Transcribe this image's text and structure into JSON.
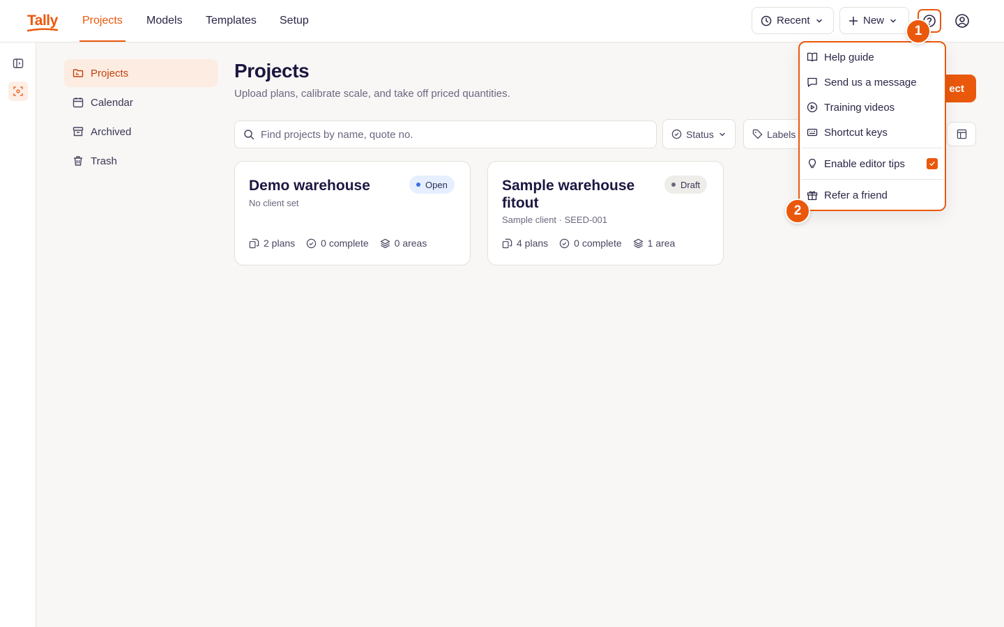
{
  "app": {
    "logo": "Tally",
    "accent": "#ea580c"
  },
  "nav": {
    "tabs": [
      {
        "label": "Projects",
        "active": true
      },
      {
        "label": "Models"
      },
      {
        "label": "Templates"
      },
      {
        "label": "Setup"
      }
    ]
  },
  "toolbar": {
    "recent_label": "Recent",
    "new_label": "New"
  },
  "rail": {
    "icons": [
      "sidebar-toggle-icon",
      "scan-icon"
    ]
  },
  "sidenav": {
    "items": [
      {
        "label": "Projects",
        "icon": "folder-icon",
        "active": true
      },
      {
        "label": "Calendar",
        "icon": "calendar-icon"
      },
      {
        "label": "Archived",
        "icon": "archive-icon"
      },
      {
        "label": "Trash",
        "icon": "trash-icon"
      }
    ]
  },
  "main": {
    "title": "Projects",
    "subtitle": "Upload plans, calibrate scale, and take off priced quantities.",
    "new_project_label": "ect",
    "search": {
      "placeholder": "Find projects by name, quote no.",
      "value": ""
    },
    "filters": {
      "status": "Status",
      "labels": "Labels"
    }
  },
  "projects": [
    {
      "title": "Demo warehouse",
      "client": "No client set",
      "status": "Open",
      "plans": "2 plans",
      "complete": "0 complete",
      "areas": "0 areas"
    },
    {
      "title": "Sample warehouse fitout",
      "client": "Sample client · SEED-001",
      "status": "Draft",
      "plans": "4 plans",
      "complete": "0 complete",
      "areas": "1 area"
    }
  ],
  "help_menu": {
    "items": [
      {
        "label": "Help guide",
        "icon": "book-icon"
      },
      {
        "label": "Send us a message",
        "icon": "message-icon"
      },
      {
        "label": "Training videos",
        "icon": "play-circle-icon"
      },
      {
        "label": "Shortcut keys",
        "icon": "keyboard-icon"
      }
    ],
    "editor_tips": {
      "label": "Enable editor tips",
      "icon": "lightbulb-icon",
      "checked": true
    },
    "refer": {
      "label": "Refer a friend",
      "icon": "gift-icon"
    }
  },
  "markers": [
    "1",
    "2"
  ]
}
